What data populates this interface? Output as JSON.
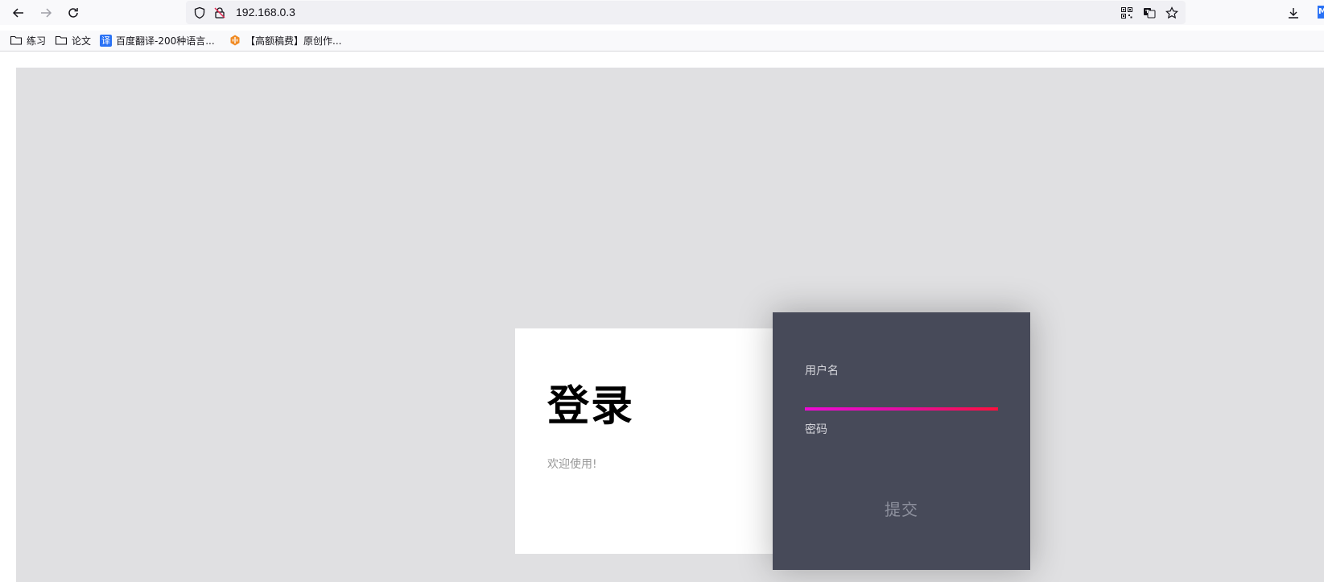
{
  "browser": {
    "url": "192.168.0.3",
    "bookmarks": [
      {
        "label": "练习",
        "icon": "folder-icon"
      },
      {
        "label": "论文",
        "icon": "folder-icon"
      },
      {
        "label": "百度翻译-200种语言...",
        "icon": "translate-favicon",
        "badge": "译"
      },
      {
        "label": "【高额稿费】原创作...",
        "icon": "bilibili-favicon"
      }
    ],
    "extension_badge": "M"
  },
  "login": {
    "title": "登录",
    "welcome": "欢迎使用!",
    "username_label": "用户名",
    "password_label": "密码",
    "submit_label": "提交"
  },
  "colors": {
    "page_bg": "#e0e0e2",
    "card_dark": "#474a59",
    "underline_gradient": [
      "#ee0ad6",
      "#ff0f3c"
    ]
  }
}
